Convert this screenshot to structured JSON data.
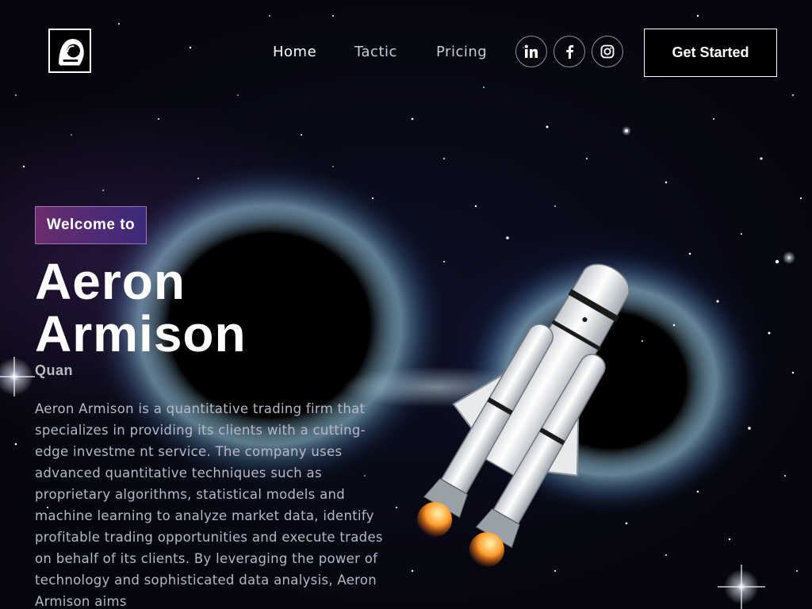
{
  "brand": {
    "logo_icon": "astronaut-helmet-icon"
  },
  "nav": {
    "items": [
      {
        "label": "Home"
      },
      {
        "label": "Tactic"
      },
      {
        "label": "Pricing"
      }
    ]
  },
  "social": {
    "items": [
      {
        "icon": "linkedin-icon"
      },
      {
        "icon": "facebook-icon"
      },
      {
        "icon": "instagram-icon"
      }
    ]
  },
  "header": {
    "cta_label": "Get Started"
  },
  "hero": {
    "badge": "Welcome to",
    "title_line1": "Aeron",
    "title_line2": "Armison",
    "subtitle": "Quan",
    "description": "Aeron Armison is a quantitative trading firm that specializes in providing its clients with a cutting-edge investme nt service. The company uses advanced quantitative techniques such as proprietary algorithms, statistical models and machine learning to analyze market data, identify profitable trading opportunities and execute trades on behalf of its clients. By leveraging the power of technology and sophisticated data analysis, Aeron Armison aims"
  },
  "colors": {
    "background": "#05060d",
    "badge_gradient_start": "#6a2c6e",
    "badge_gradient_end": "#3a2a7a",
    "text_primary": "#ffffff",
    "text_muted": "#b6b8c6"
  }
}
